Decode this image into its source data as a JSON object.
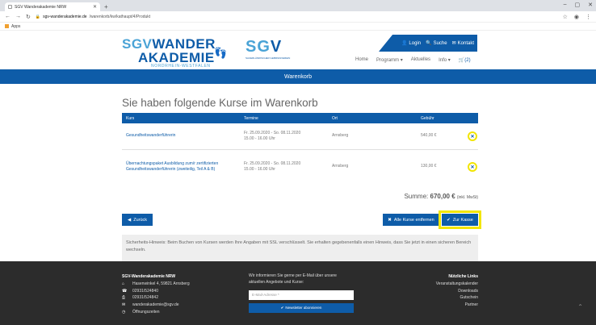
{
  "browser": {
    "tab_title": "SGV Wanderakademie NRW",
    "url_host": "sgv-wanderakademie.de",
    "url_path": "/warenkorb/kw/kathaupt/4/Produkt",
    "bookmark": "Apps"
  },
  "header": {
    "logo_wa_line1a": "SGV",
    "logo_wa_line1b": "WANDER",
    "logo_wa_line2": "AKADEMIE",
    "logo_wa_line3": "NORDRHEIN-WESTFALEN",
    "logo_sgv_a": "SG",
    "logo_sgv_b": "V",
    "logo_sgv_sub": "SAUERLÄNDISCHER GEBIRGSVEREIN",
    "login": "Login",
    "search": "Suche",
    "contact": "Kontakt",
    "nav": [
      "Home",
      "Programm ▾",
      "Aktuelles",
      "Info ▾"
    ],
    "cart": "(2)"
  },
  "bluebar": "Warenkorb",
  "content": {
    "heading": "Sie haben folgende Kurse im Warenkorb",
    "columns": [
      "Kurs",
      "Termine",
      "Ort",
      "Gebühr"
    ],
    "rows": [
      {
        "kurs": "Gesundheitswanderführerin",
        "termine_1": "Fr. 25.09.2020 - So. 08.11.2020",
        "termine_2": "15.00 - 16.00 Uhr",
        "ort": "Arnsberg",
        "gebuehr": "540,00 €"
      },
      {
        "kurs": "Übernachtungspaket Ausbildung zum/r zertifizierten Gesundheitswanderführerin (zweiteilig, Teil A & B)",
        "termine_1": "Fr. 25.09.2020 - So. 08.11.2020",
        "termine_2": "15.00 - 16.00 Uhr",
        "ort": "Arnsberg",
        "gebuehr": "130,00 €"
      }
    ],
    "sum_label": "Summe:",
    "sum_value": "670,00 €",
    "sum_note": "(inkl. MwSt)",
    "btn_back": "Zurück",
    "btn_clear": "Alle Kurse entfernen",
    "btn_checkout": "Zur Kasse",
    "notice": "Sicherheits-Hinweis: Beim Buchen von Kursen werden Ihre Angaben mit SSL verschlüsselt. Sie erhalten gegebenenfalls einen Hinweis, dass Sie jetzt in einen sicheren Bereich wechseln."
  },
  "footer": {
    "org": "SGV-Wanderakademie NRW",
    "address": "Hasenwinkel 4, 59821 Arnsberg",
    "phone": "02931/524840",
    "fax": "02931/524842",
    "email": "wanderakademie@sgv.de",
    "hours": "Öffnungszeiten",
    "newsletter_text": "Wir informieren Sie gerne per E-Mail über unsere aktuellen Angebote und Kurse:",
    "newsletter_placeholder": "E-Mail-Adresse *",
    "newsletter_button": "Newsletter abonnieren",
    "links_title": "Nützliche Links",
    "links": [
      "Veranstaltungskalender",
      "Downloads",
      "Gutschein",
      "Partner"
    ]
  }
}
